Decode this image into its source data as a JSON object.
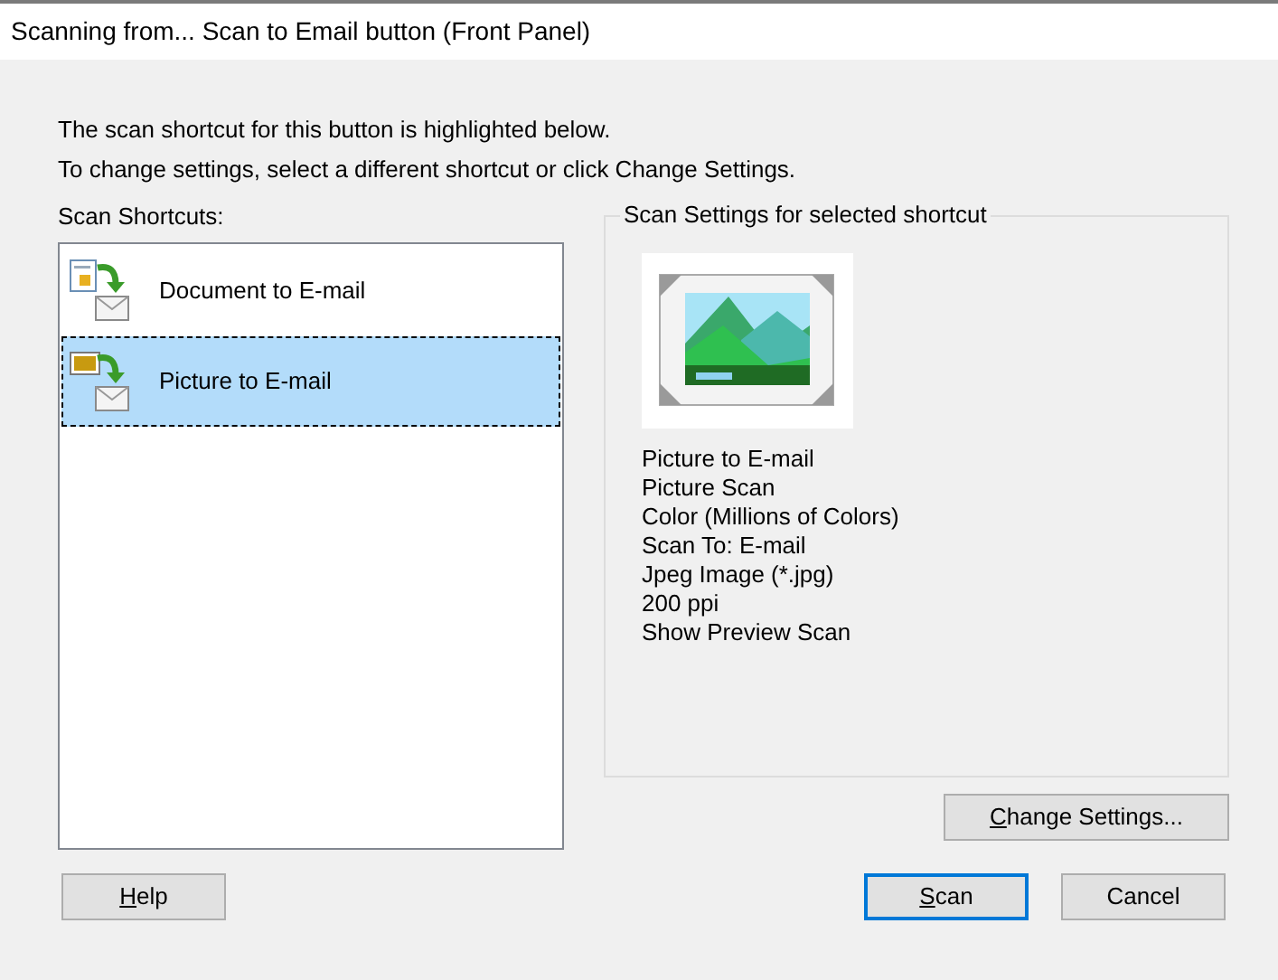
{
  "window": {
    "title": "Scanning from... Scan to Email button (Front Panel)"
  },
  "intro": [
    "The scan shortcut for this button is highlighted below.",
    "To change settings, select a different shortcut or click Change Settings."
  ],
  "shortcuts_label": "Scan Shortcuts:",
  "shortcuts": [
    {
      "label": "Document to E-mail",
      "kind": "document",
      "selected": false
    },
    {
      "label": "Picture to E-mail",
      "kind": "picture",
      "selected": true
    }
  ],
  "settings": {
    "title": "Scan Settings for selected shortcut",
    "lines": [
      "Picture to E-mail",
      "Picture Scan",
      "Color (Millions of Colors)",
      "Scan To: E-mail",
      "Jpeg Image (*.jpg)",
      "200 ppi",
      "Show Preview Scan"
    ]
  },
  "change_button": {
    "label": "Change Settings...",
    "access_key_underlined": true
  },
  "buttons": [
    {
      "label": "Help",
      "access_key_underlined": true,
      "default": false
    },
    {
      "label": "Scan",
      "access_key_underlined": true,
      "default": true
    },
    {
      "label": "Cancel",
      "access_key_underlined": false,
      "default": false
    }
  ]
}
